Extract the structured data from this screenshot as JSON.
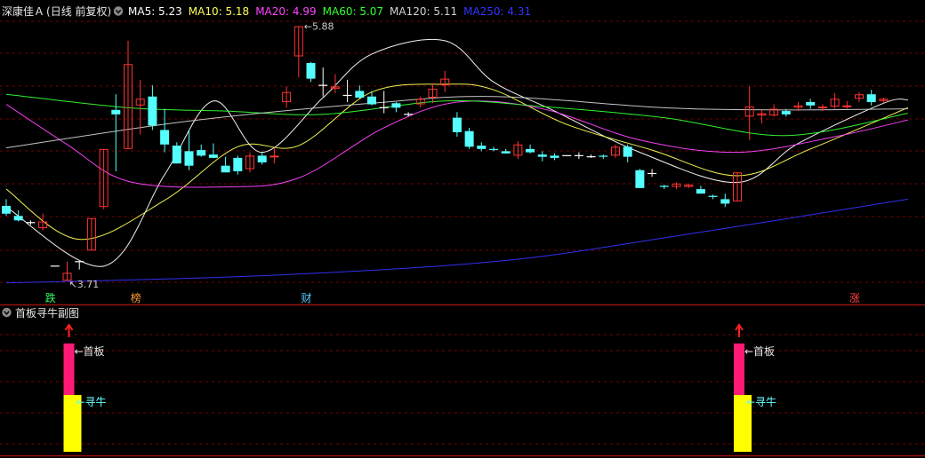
{
  "header": {
    "stock_name": "深康佳Ａ",
    "period": "(日线 前复权)",
    "ma": [
      {
        "label": "MA5:",
        "value": "5.23",
        "color": "#ffffff"
      },
      {
        "label": "MA10:",
        "value": "5.18",
        "color": "#ffff55"
      },
      {
        "label": "MA20:",
        "value": "4.99",
        "color": "#ff44ff"
      },
      {
        "label": "MA60:",
        "value": "5.07",
        "color": "#33ff33"
      },
      {
        "label": "MA120:",
        "value": "5.11",
        "color": "#cfcfcf"
      },
      {
        "label": "MA250:",
        "value": "4.31",
        "color": "#3333ff"
      }
    ]
  },
  "sub_panel": {
    "title": "首板寻牛副图",
    "label_top": "←首板",
    "label_bottom": "←寻牛",
    "colors": {
      "top": "#ff1a75",
      "bottom": "#ffff00",
      "arrow": "#ff2020"
    }
  },
  "event_tags": [
    {
      "text": "跌",
      "color": "#33ff66",
      "bar_index": 4
    },
    {
      "text": "榜",
      "color": "#ff9933",
      "bar_index": 11
    },
    {
      "text": "财",
      "color": "#55ccff",
      "bar_index": 25
    },
    {
      "text": "涨",
      "color": "#ff4444",
      "bar_index": 70
    }
  ],
  "annotations": {
    "high": "5.88",
    "low": "3.71"
  },
  "colors": {
    "up": "#ff3333",
    "down": "#55ffff",
    "grid": "#7a0000",
    "panel_line": "#9a1010"
  },
  "chart_data": {
    "type": "candlestick",
    "ylim": [
      3.6,
      6.05
    ],
    "candles": [
      {
        "o": 4.38,
        "h": 4.44,
        "l": 4.29,
        "c": 4.31
      },
      {
        "o": 4.29,
        "h": 4.34,
        "l": 4.24,
        "c": 4.25
      },
      {
        "o": 4.23,
        "h": 4.25,
        "l": 4.21,
        "c": 4.23
      },
      {
        "o": 4.18,
        "h": 4.31,
        "l": 4.16,
        "c": 4.24
      },
      {
        "o": 3.84,
        "h": 3.84,
        "l": 3.84,
        "c": 3.84
      },
      {
        "o": 3.71,
        "h": 3.88,
        "l": 3.71,
        "c": 3.78
      },
      {
        "o": 3.88,
        "h": 3.88,
        "l": 3.81,
        "c": 3.88
      },
      {
        "o": 3.98,
        "h": 4.27,
        "l": 3.98,
        "c": 4.27
      },
      {
        "o": 4.37,
        "h": 4.89,
        "l": 4.35,
        "c": 4.89
      },
      {
        "o": 5.24,
        "h": 5.38,
        "l": 4.69,
        "c": 5.2
      },
      {
        "o": 4.89,
        "h": 5.86,
        "l": 4.89,
        "c": 5.65
      },
      {
        "o": 5.28,
        "h": 5.51,
        "l": 5.02,
        "c": 5.34
      },
      {
        "o": 5.36,
        "h": 5.46,
        "l": 5.06,
        "c": 5.1
      },
      {
        "o": 5.06,
        "h": 5.25,
        "l": 4.86,
        "c": 4.93
      },
      {
        "o": 4.92,
        "h": 4.95,
        "l": 4.76,
        "c": 4.76
      },
      {
        "o": 4.87,
        "h": 5.06,
        "l": 4.7,
        "c": 4.74
      },
      {
        "o": 4.88,
        "h": 4.93,
        "l": 4.82,
        "c": 4.83
      },
      {
        "o": 4.84,
        "h": 4.94,
        "l": 4.81,
        "c": 4.81
      },
      {
        "o": 4.74,
        "h": 4.82,
        "l": 4.68,
        "c": 4.68
      },
      {
        "o": 4.81,
        "h": 4.83,
        "l": 4.66,
        "c": 4.69
      },
      {
        "o": 4.71,
        "h": 4.86,
        "l": 4.68,
        "c": 4.83
      },
      {
        "o": 4.83,
        "h": 4.86,
        "l": 4.75,
        "c": 4.77
      },
      {
        "o": 4.82,
        "h": 4.9,
        "l": 4.76,
        "c": 4.83
      },
      {
        "o": 5.31,
        "h": 5.45,
        "l": 5.26,
        "c": 5.4
      },
      {
        "o": 5.72,
        "h": 5.99,
        "l": 5.53,
        "c": 5.99
      },
      {
        "o": 5.66,
        "h": 5.67,
        "l": 5.49,
        "c": 5.52
      },
      {
        "o": 5.46,
        "h": 5.62,
        "l": 5.36,
        "c": 5.46
      },
      {
        "o": 5.43,
        "h": 5.56,
        "l": 5.39,
        "c": 5.45
      },
      {
        "o": 5.37,
        "h": 5.51,
        "l": 5.31,
        "c": 5.37
      },
      {
        "o": 5.41,
        "h": 5.46,
        "l": 5.34,
        "c": 5.35
      },
      {
        "o": 5.36,
        "h": 5.41,
        "l": 5.28,
        "c": 5.29
      },
      {
        "o": 5.26,
        "h": 5.41,
        "l": 5.21,
        "c": 5.26
      },
      {
        "o": 5.3,
        "h": 5.31,
        "l": 5.22,
        "c": 5.26
      },
      {
        "o": 5.2,
        "h": 5.22,
        "l": 5.18,
        "c": 5.2
      },
      {
        "o": 5.29,
        "h": 5.36,
        "l": 5.26,
        "c": 5.34
      },
      {
        "o": 5.35,
        "h": 5.48,
        "l": 5.3,
        "c": 5.43
      },
      {
        "o": 5.46,
        "h": 5.59,
        "l": 5.4,
        "c": 5.52
      },
      {
        "o": 5.17,
        "h": 5.22,
        "l": 5.0,
        "c": 5.04
      },
      {
        "o": 5.05,
        "h": 5.08,
        "l": 4.89,
        "c": 4.91
      },
      {
        "o": 4.92,
        "h": 4.95,
        "l": 4.87,
        "c": 4.89
      },
      {
        "o": 4.89,
        "h": 4.91,
        "l": 4.87,
        "c": 4.88
      },
      {
        "o": 4.87,
        "h": 4.89,
        "l": 4.85,
        "c": 4.85
      },
      {
        "o": 4.83,
        "h": 4.96,
        "l": 4.8,
        "c": 4.93
      },
      {
        "o": 4.89,
        "h": 4.93,
        "l": 4.85,
        "c": 4.86
      },
      {
        "o": 4.84,
        "h": 4.87,
        "l": 4.78,
        "c": 4.82
      },
      {
        "o": 4.83,
        "h": 4.85,
        "l": 4.79,
        "c": 4.81
      },
      {
        "o": 4.83,
        "h": 4.83,
        "l": 4.83,
        "c": 4.83
      },
      {
        "o": 4.83,
        "h": 4.86,
        "l": 4.8,
        "c": 4.83
      },
      {
        "o": 4.82,
        "h": 4.84,
        "l": 4.81,
        "c": 4.82
      },
      {
        "o": 4.83,
        "h": 4.84,
        "l": 4.8,
        "c": 4.82
      },
      {
        "o": 4.83,
        "h": 4.93,
        "l": 4.81,
        "c": 4.91
      },
      {
        "o": 4.91,
        "h": 4.93,
        "l": 4.77,
        "c": 4.82
      },
      {
        "o": 4.7,
        "h": 4.71,
        "l": 4.54,
        "c": 4.54
      },
      {
        "o": 4.67,
        "h": 4.71,
        "l": 4.64,
        "c": 4.67
      },
      {
        "o": 4.56,
        "h": 4.57,
        "l": 4.53,
        "c": 4.55
      },
      {
        "o": 4.55,
        "h": 4.59,
        "l": 4.53,
        "c": 4.58
      },
      {
        "o": 4.55,
        "h": 4.58,
        "l": 4.54,
        "c": 4.57
      },
      {
        "o": 4.53,
        "h": 4.56,
        "l": 4.49,
        "c": 4.49
      },
      {
        "o": 4.47,
        "h": 4.48,
        "l": 4.44,
        "c": 4.46
      },
      {
        "o": 4.44,
        "h": 4.49,
        "l": 4.37,
        "c": 4.4
      },
      {
        "o": 4.42,
        "h": 4.68,
        "l": 4.42,
        "c": 4.68
      },
      {
        "o": 5.18,
        "h": 5.45,
        "l": 4.97,
        "c": 5.27
      },
      {
        "o": 5.19,
        "h": 5.24,
        "l": 5.12,
        "c": 5.21
      },
      {
        "o": 5.19,
        "h": 5.29,
        "l": 5.18,
        "c": 5.25
      },
      {
        "o": 5.23,
        "h": 5.25,
        "l": 5.18,
        "c": 5.2
      },
      {
        "o": 5.26,
        "h": 5.31,
        "l": 5.23,
        "c": 5.28
      },
      {
        "o": 5.31,
        "h": 5.34,
        "l": 5.25,
        "c": 5.28
      },
      {
        "o": 5.26,
        "h": 5.29,
        "l": 5.23,
        "c": 5.27
      },
      {
        "o": 5.27,
        "h": 5.39,
        "l": 5.25,
        "c": 5.34
      },
      {
        "o": 5.27,
        "h": 5.32,
        "l": 5.25,
        "c": 5.28
      },
      {
        "o": 5.34,
        "h": 5.4,
        "l": 5.31,
        "c": 5.38
      },
      {
        "o": 5.38,
        "h": 5.42,
        "l": 5.28,
        "c": 5.31
      },
      {
        "o": 5.32,
        "h": 5.35,
        "l": 5.3,
        "c": 5.34
      }
    ],
    "ma_lines": {
      "MA5": [
        [
          0,
          4.37
        ],
        [
          8,
          3.84
        ],
        [
          13,
          4.66
        ],
        [
          17,
          5.32
        ],
        [
          21,
          4.86
        ],
        [
          26,
          5.35
        ],
        [
          30,
          5.74
        ],
        [
          36,
          5.86
        ],
        [
          40,
          5.49
        ],
        [
          45,
          5.23
        ],
        [
          52,
          4.86
        ],
        [
          60,
          4.59
        ],
        [
          65,
          4.94
        ],
        [
          72,
          5.3
        ],
        [
          74,
          5.33
        ]
      ],
      "MA10": [
        [
          0,
          4.53
        ],
        [
          6,
          4.08
        ],
        [
          13,
          4.43
        ],
        [
          19,
          4.91
        ],
        [
          24,
          4.92
        ],
        [
          30,
          5.4
        ],
        [
          36,
          5.47
        ],
        [
          40,
          5.42
        ],
        [
          46,
          5.11
        ],
        [
          53,
          4.88
        ],
        [
          60,
          4.65
        ],
        [
          66,
          4.89
        ],
        [
          74,
          5.26
        ]
      ],
      "MA20": [
        [
          0,
          5.29
        ],
        [
          5,
          4.93
        ],
        [
          10,
          4.6
        ],
        [
          18,
          4.55
        ],
        [
          24,
          4.63
        ],
        [
          31,
          5.08
        ],
        [
          37,
          5.31
        ],
        [
          44,
          5.25
        ],
        [
          52,
          4.97
        ],
        [
          60,
          4.86
        ],
        [
          68,
          5.0
        ],
        [
          74,
          5.15
        ]
      ],
      "MA60": [
        [
          0,
          5.38
        ],
        [
          10,
          5.26
        ],
        [
          18,
          5.23
        ],
        [
          26,
          5.2
        ],
        [
          36,
          5.32
        ],
        [
          44,
          5.27
        ],
        [
          54,
          5.17
        ],
        [
          64,
          5.01
        ],
        [
          74,
          5.21
        ]
      ],
      "MA120": [
        [
          0,
          4.9
        ],
        [
          15,
          5.14
        ],
        [
          30,
          5.3
        ],
        [
          40,
          5.36
        ],
        [
          54,
          5.26
        ],
        [
          64,
          5.24
        ],
        [
          74,
          5.25
        ]
      ],
      "MA250": [
        [
          0,
          3.69
        ],
        [
          20,
          3.75
        ],
        [
          40,
          3.88
        ],
        [
          55,
          4.11
        ],
        [
          74,
          4.44
        ]
      ]
    },
    "sub_signals": [
      5,
      60
    ]
  }
}
